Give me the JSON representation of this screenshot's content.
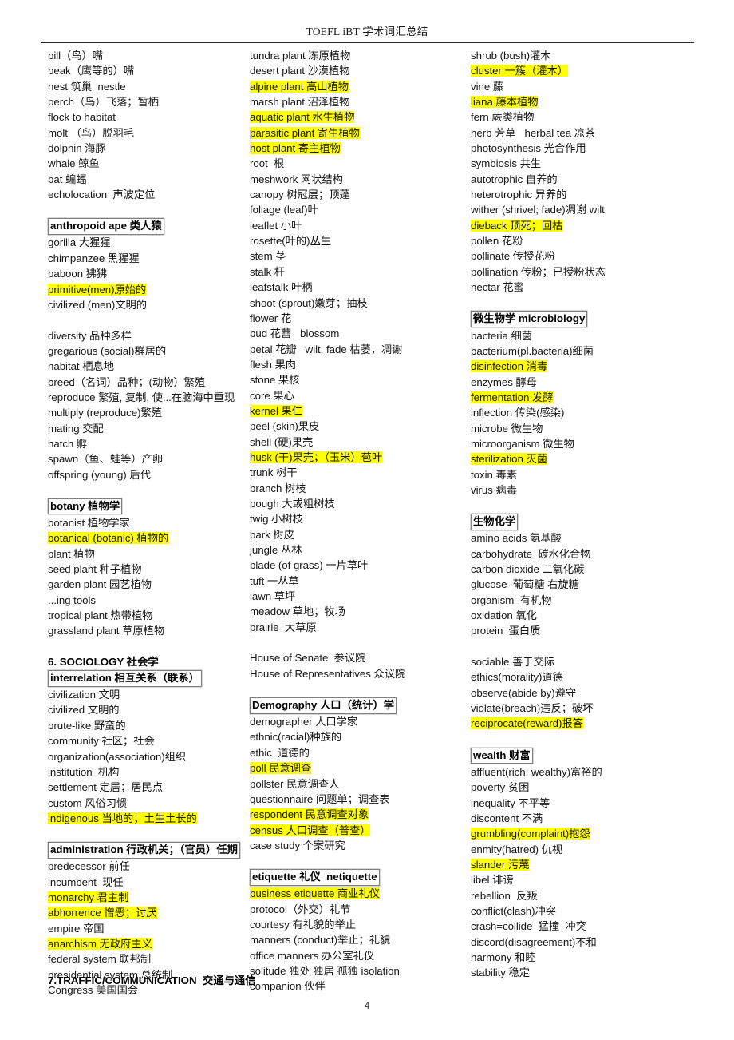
{
  "header": {
    "title": "TOEFL iBT  学术词汇总结"
  },
  "footer": {
    "page_number": "4",
    "bottom_heading": "7.TRAFFIC/COMMUNICATION  交通与通信"
  },
  "colors": {
    "highlight": "#ffff00",
    "text": "#161616",
    "rule": "#2b2b2b",
    "box_border": "#808080"
  },
  "columns": [
    {
      "id": "column-left",
      "blocks": [
        {
          "type": "list",
          "items": [
            {
              "text": "bill（鸟）嘴",
              "style": "plain"
            },
            {
              "text": "beak（鹰等的）嘴",
              "style": "plain"
            },
            {
              "text": "nest 筑巢  nestle",
              "style": "plain"
            },
            {
              "text": "perch（鸟）飞落；暂栖",
              "style": "plain"
            },
            {
              "text": "flock to habitat",
              "style": "plain"
            },
            {
              "text": "molt （鸟）脱羽毛",
              "style": "plain"
            },
            {
              "text": "dolphin 海豚",
              "style": "plain"
            },
            {
              "text": "whale 鲸鱼",
              "style": "plain"
            },
            {
              "text": "bat 蝙蝠",
              "style": "plain"
            },
            {
              "text": "echolocation  声波定位",
              "style": "plain"
            }
          ]
        },
        {
          "type": "spacer"
        },
        {
          "type": "boxed",
          "text": "anthropoid ape 类人猿"
        },
        {
          "type": "list",
          "items": [
            {
              "text": "gorilla 大猩猩",
              "style": "plain"
            },
            {
              "text": "chimpanzee 黑猩猩",
              "style": "plain"
            },
            {
              "text": "baboon 狒狒",
              "style": "plain"
            },
            {
              "text": "primitive(men)原始的",
              "style": "highlight"
            },
            {
              "text": "civilized (men)文明的",
              "style": "plain"
            }
          ]
        },
        {
          "type": "spacer"
        },
        {
          "type": "list",
          "items": [
            {
              "text": "diversity 品种多样",
              "style": "plain"
            },
            {
              "text": "gregarious (social)群居的",
              "style": "plain"
            },
            {
              "text": "habitat 栖息地",
              "style": "plain"
            },
            {
              "text": "breed（名词）品种；(动物）繁殖",
              "style": "plain"
            },
            {
              "text": "reproduce 繁殖, 复制, 使...在脑海中重现",
              "style": "plain"
            },
            {
              "text": "multiply (reproduce)繁殖",
              "style": "plain"
            },
            {
              "text": "mating 交配",
              "style": "plain"
            },
            {
              "text": "hatch 孵",
              "style": "plain"
            },
            {
              "text": "spawn（鱼、蛙等）产卵",
              "style": "plain"
            },
            {
              "text": "offspring (young) 后代",
              "style": "plain"
            }
          ]
        },
        {
          "type": "spacer"
        },
        {
          "type": "boxed",
          "text": "botany 植物学"
        },
        {
          "type": "list",
          "items": [
            {
              "text": "botanist 植物学家",
              "style": "plain"
            },
            {
              "text": "botanical (botanic) 植物的",
              "style": "highlight"
            },
            {
              "text": "plant 植物",
              "style": "plain"
            },
            {
              "text": "seed plant 种子植物",
              "style": "plain"
            },
            {
              "text": "garden plant 园艺植物",
              "style": "plain"
            },
            {
              "text": "...ing tools",
              "style": "plain"
            },
            {
              "text": "tropical plant 热带植物",
              "style": "plain"
            },
            {
              "text": "grassland plant 草原植物",
              "style": "plain"
            }
          ]
        },
        {
          "type": "spacer"
        },
        {
          "type": "bold",
          "text": "6. SOCIOLOGY 社会学"
        },
        {
          "type": "boxed",
          "text": "interrelation 相互关系（联系）"
        },
        {
          "type": "list",
          "items": [
            {
              "text": "civilization 文明",
              "style": "plain"
            },
            {
              "text": "civilized 文明的",
              "style": "plain"
            },
            {
              "text": "brute-like 野蛮的",
              "style": "plain"
            },
            {
              "text": "community 社区；社会",
              "style": "plain"
            },
            {
              "text": "organization(association)组织",
              "style": "plain"
            },
            {
              "text": "institution  机构",
              "style": "plain"
            },
            {
              "text": "settlement 定居；居民点",
              "style": "plain"
            },
            {
              "text": "custom 风俗习惯",
              "style": "plain"
            },
            {
              "text": "indigenous 当地的；土生土长的",
              "style": "highlight"
            }
          ]
        },
        {
          "type": "spacer"
        },
        {
          "type": "boxed",
          "text": "administration 行政机关；（官员）任期"
        },
        {
          "type": "list",
          "items": [
            {
              "text": "predecessor 前任",
              "style": "plain"
            },
            {
              "text": "incumbent  现任",
              "style": "plain"
            },
            {
              "text": "monarchy 君主制",
              "style": "highlight"
            },
            {
              "text": "abhorrence 憎恶；讨厌",
              "style": "highlight"
            },
            {
              "text": "empire 帝国",
              "style": "plain"
            },
            {
              "text": "anarchism 无政府主义",
              "style": "highlight"
            },
            {
              "text": "federal system 联邦制",
              "style": "plain"
            },
            {
              "text": "presidential system 总统制",
              "style": "plain"
            },
            {
              "text": "Congress 美国国会",
              "style": "plain"
            }
          ]
        }
      ]
    },
    {
      "id": "column-middle",
      "blocks": [
        {
          "type": "list",
          "items": [
            {
              "text": "tundra plant 冻原植物",
              "style": "plain"
            },
            {
              "text": "desert plant 沙漠植物",
              "style": "plain"
            },
            {
              "text": "alpine plant 高山植物",
              "style": "highlight"
            },
            {
              "text": "marsh plant 沼泽植物",
              "style": "plain"
            },
            {
              "text": "aquatic plant 水生植物",
              "style": "highlight"
            },
            {
              "text": "parasitic plant 寄生植物",
              "style": "highlight"
            },
            {
              "text": "host plant 寄主植物",
              "style": "highlight"
            },
            {
              "text": "root  根",
              "style": "plain"
            },
            {
              "text": "meshwork 网状结构",
              "style": "plain"
            },
            {
              "text": "canopy 树冠层；顶蓬",
              "style": "plain"
            },
            {
              "text": "foliage (leaf)叶",
              "style": "plain"
            },
            {
              "text": "leaflet 小叶",
              "style": "plain"
            },
            {
              "text": "rosette(叶的)丛生",
              "style": "plain"
            },
            {
              "text": "stem 茎",
              "style": "plain"
            },
            {
              "text": "stalk 杆",
              "style": "plain"
            },
            {
              "text": "leafstalk 叶柄",
              "style": "plain"
            },
            {
              "text": "shoot (sprout)嫩芽；抽枝",
              "style": "plain"
            },
            {
              "text": "flower 花",
              "style": "plain"
            },
            {
              "text": "bud 花蕾   blossom",
              "style": "plain"
            },
            {
              "text": "petal 花瓣   wilt, fade 枯萎，凋谢",
              "style": "plain"
            },
            {
              "text": "flesh 果肉",
              "style": "plain"
            },
            {
              "text": "stone 果核",
              "style": "plain"
            },
            {
              "text": "core 果心",
              "style": "plain"
            },
            {
              "text": "kernel 果仁",
              "style": "highlight"
            },
            {
              "text": "peel (skin)果皮",
              "style": "plain"
            },
            {
              "text": "shell (硬)果壳",
              "style": "plain"
            },
            {
              "text": "husk (干)果壳；（玉米）苞叶",
              "style": "highlight"
            },
            {
              "text": "trunk 树干",
              "style": "plain"
            },
            {
              "text": "branch 树枝",
              "style": "plain"
            },
            {
              "text": "bough 大或粗树枝",
              "style": "plain"
            },
            {
              "text": "twig 小树枝",
              "style": "plain"
            },
            {
              "text": "bark 树皮",
              "style": "plain"
            },
            {
              "text": "jungle 丛林",
              "style": "plain"
            },
            {
              "text": "blade (of grass) 一片草叶",
              "style": "plain"
            },
            {
              "text": "tuft 一丛草",
              "style": "plain"
            },
            {
              "text": "lawn 草坪",
              "style": "plain"
            },
            {
              "text": "meadow 草地；牧场",
              "style": "plain"
            },
            {
              "text": "prairie  大草原",
              "style": "plain"
            }
          ]
        },
        {
          "type": "spacer"
        },
        {
          "type": "list",
          "items": [
            {
              "text": "House of Senate  参议院",
              "style": "plain"
            },
            {
              "text": "House of Representatives 众议院",
              "style": "plain"
            }
          ]
        },
        {
          "type": "spacer"
        },
        {
          "type": "boxed",
          "text": "Demography 人口（统计）学"
        },
        {
          "type": "list",
          "items": [
            {
              "text": "demographer 人口学家",
              "style": "plain"
            },
            {
              "text": "ethnic(racial)种族的",
              "style": "plain"
            },
            {
              "text": "ethic  道德的",
              "style": "plain"
            },
            {
              "text": "poll 民意调查",
              "style": "highlight"
            },
            {
              "text": "pollster 民意调查人",
              "style": "plain"
            },
            {
              "text": "questionnaire 问题单；调查表",
              "style": "plain"
            },
            {
              "text": "respondent 民意调查对象",
              "style": "highlight"
            },
            {
              "text": "census 人口调查（普查）",
              "style": "highlight"
            },
            {
              "text": "case study 个案研究",
              "style": "plain"
            }
          ]
        },
        {
          "type": "spacer"
        },
        {
          "type": "boxed",
          "text": "etiquette 礼仪  netiquette"
        },
        {
          "type": "list",
          "items": [
            {
              "text": "business etiquette 商业礼仪",
              "style": "highlight"
            },
            {
              "text": "protocol（外交）礼节",
              "style": "plain"
            },
            {
              "text": "courtesy 有礼貌的举止",
              "style": "plain"
            },
            {
              "text": "manners (conduct)举止；礼貌",
              "style": "plain"
            },
            {
              "text": "office manners 办公室礼仪",
              "style": "plain"
            },
            {
              "text": "solitude 独处 独居 孤独 isolation",
              "style": "plain"
            },
            {
              "text": "companion 伙伴",
              "style": "plain"
            }
          ]
        }
      ]
    },
    {
      "id": "column-right",
      "blocks": [
        {
          "type": "list",
          "items": [
            {
              "text": "shrub (bush)灌木",
              "style": "plain"
            },
            {
              "text": "cluster 一簇（灌木）",
              "style": "highlight"
            },
            {
              "text": "vine 藤",
              "style": "plain"
            },
            {
              "text": "liana 藤本植物",
              "style": "highlight"
            },
            {
              "text": "fern 蕨类植物",
              "style": "plain"
            },
            {
              "text": "herb 芳草   herbal tea 凉茶",
              "style": "plain"
            },
            {
              "text": "photosynthesis 光合作用",
              "style": "plain"
            },
            {
              "text": "symbiosis 共生",
              "style": "plain"
            },
            {
              "text": "autotrophic 自养的",
              "style": "plain"
            },
            {
              "text": "heterotrophic 异养的",
              "style": "plain"
            },
            {
              "text": "wither (shrivel; fade)凋谢 wilt",
              "style": "plain"
            },
            {
              "text": "dieback 顶死；回枯",
              "style": "highlight"
            },
            {
              "text": "pollen 花粉",
              "style": "plain"
            },
            {
              "text": "pollinate 传授花粉",
              "style": "plain"
            },
            {
              "text": "pollination 传粉；已授粉状态",
              "style": "plain"
            },
            {
              "text": "nectar 花蜜",
              "style": "plain"
            }
          ]
        },
        {
          "type": "spacer"
        },
        {
          "type": "boxed",
          "text": "微生物学 microbiology"
        },
        {
          "type": "list",
          "items": [
            {
              "text": "bacteria 细菌",
              "style": "plain"
            },
            {
              "text": "bacterium(pl.bacteria)细菌",
              "style": "plain"
            },
            {
              "text": "disinfection 消毒",
              "style": "highlight"
            },
            {
              "text": "enzymes 酵母",
              "style": "plain"
            },
            {
              "text": "fermentation 发酵",
              "style": "highlight"
            },
            {
              "text": "inflection 传染(感染)",
              "style": "plain"
            },
            {
              "text": "microbe 微生物",
              "style": "plain"
            },
            {
              "text": "microorganism 微生物",
              "style": "plain"
            },
            {
              "text": "sterilization 灭菌",
              "style": "highlight"
            },
            {
              "text": "toxin 毒素",
              "style": "plain"
            },
            {
              "text": "virus 病毒",
              "style": "plain"
            }
          ]
        },
        {
          "type": "spacer"
        },
        {
          "type": "boxed",
          "text": "生物化学"
        },
        {
          "type": "list",
          "items": [
            {
              "text": "amino acids 氨基酸",
              "style": "plain"
            },
            {
              "text": "carbohydrate  碳水化合物",
              "style": "plain"
            },
            {
              "text": "carbon dioxide 二氧化碳",
              "style": "plain"
            },
            {
              "text": "glucose  葡萄糖 右旋糖",
              "style": "plain"
            },
            {
              "text": "organism  有机物",
              "style": "plain"
            },
            {
              "text": "oxidation 氧化",
              "style": "plain"
            },
            {
              "text": "protein  蛋白质",
              "style": "plain"
            }
          ]
        },
        {
          "type": "spacer"
        },
        {
          "type": "list",
          "items": [
            {
              "text": "sociable 善于交际",
              "style": "plain"
            },
            {
              "text": "ethics(morality)道德",
              "style": "plain"
            },
            {
              "text": "observe(abide by)遵守",
              "style": "plain"
            },
            {
              "text": "violate(breach)违反；破坏",
              "style": "plain"
            },
            {
              "text": "reciprocate(reward)报答",
              "style": "highlight"
            }
          ]
        },
        {
          "type": "spacer"
        },
        {
          "type": "boxed",
          "text": "wealth 财富"
        },
        {
          "type": "list",
          "items": [
            {
              "text": "affluent(rich; wealthy)富裕的",
              "style": "plain"
            },
            {
              "text": "poverty 贫困",
              "style": "plain"
            },
            {
              "text": "inequality 不平等",
              "style": "plain"
            },
            {
              "text": "discontent 不满",
              "style": "plain"
            },
            {
              "text": "grumbling(complaint)抱怨",
              "style": "highlight"
            },
            {
              "text": "enmity(hatred) 仇视",
              "style": "plain"
            },
            {
              "text": "slander 污蔑",
              "style": "highlight"
            },
            {
              "text": "libel 诽谤",
              "style": "plain"
            },
            {
              "text": "rebellion  反叛",
              "style": "plain"
            },
            {
              "text": "conflict(clash)冲突",
              "style": "plain"
            },
            {
              "text": "crash=collide  猛撞  冲突",
              "style": "plain"
            },
            {
              "text": "discord(disagreement)不和",
              "style": "plain"
            },
            {
              "text": "harmony 和睦",
              "style": "plain"
            },
            {
              "text": "stability 稳定",
              "style": "plain"
            }
          ]
        }
      ]
    }
  ]
}
